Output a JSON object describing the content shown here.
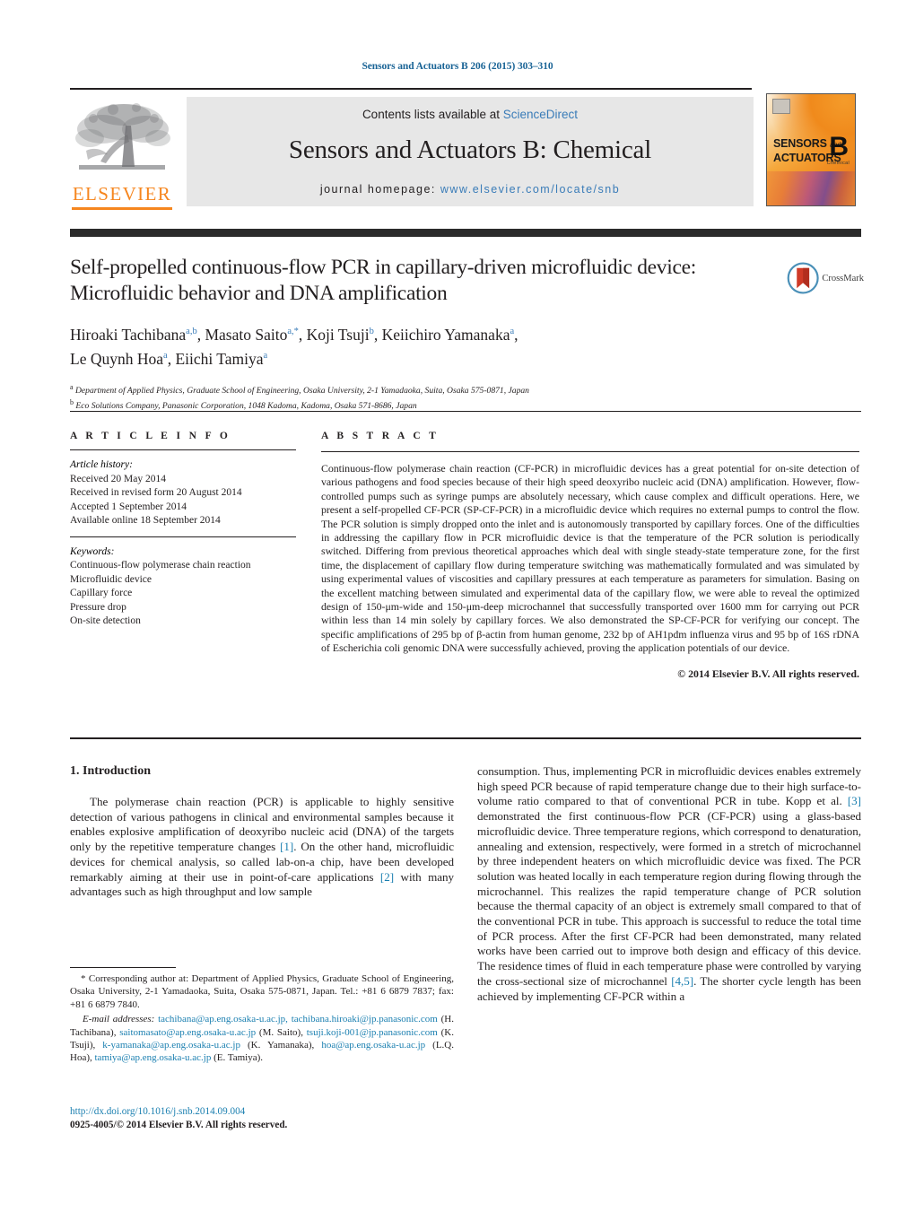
{
  "running_head": "Sensors and Actuators B 206 (2015) 303–310",
  "masthead": {
    "publisher_logo_text": "ELSEVIER",
    "contents_prefix": "Contents lists available at ",
    "contents_link": "ScienceDirect",
    "journal_title": "Sensors and Actuators B: Chemical",
    "homepage_prefix": "journal homepage: ",
    "homepage_url": "www.elsevier.com/locate/snb",
    "cover": {
      "line1": "SENSORS",
      "and": "and",
      "line2": "ACTUATORS",
      "letter": "B",
      "sub": "Chemical"
    }
  },
  "article": {
    "title": "Self-propelled continuous-flow PCR in capillary-driven microfluidic device: Microfluidic behavior and DNA amplification",
    "authors_line1_a": "Hiroaki Tachibana",
    "authors_line1_a_sup": "a,b",
    "authors_line1_b": ", Masato Saito",
    "authors_line1_b_sup": "a,*",
    "authors_line1_c": ", Koji Tsuji",
    "authors_line1_c_sup": "b",
    "authors_line1_d": ", Keiichiro Yamanaka",
    "authors_line1_d_sup": "a",
    "authors_line1_end": ",",
    "authors_line2_a": "Le Quynh Hoa",
    "authors_line2_a_sup": "a",
    "authors_line2_b": ", Eiichi Tamiya",
    "authors_line2_b_sup": "a",
    "affiliation_a_sup": "a",
    "affiliation_a": " Department of Applied Physics, Graduate School of Engineering, Osaka University, 2-1 Yamadaoka, Suita, Osaka 575-0871, Japan",
    "affiliation_b_sup": "b",
    "affiliation_b": " Eco Solutions Company, Panasonic Corporation, 1048 Kadoma, Kadoma, Osaka 571-8686, Japan",
    "crossmark_label": "CrossMark"
  },
  "article_info": {
    "heading": "A R T I C L E  I N F O",
    "history_title": "Article history:",
    "history": [
      "Received 20 May 2014",
      "Received in revised form 20 August 2014",
      "Accepted 1 September 2014",
      "Available online 18 September 2014"
    ],
    "keywords_title": "Keywords:",
    "keywords": [
      "Continuous-flow polymerase chain reaction",
      "Microfluidic device",
      "Capillary force",
      "Pressure drop",
      "On-site detection"
    ]
  },
  "abstract": {
    "heading": "A B S T R A C T",
    "text": "Continuous-flow polymerase chain reaction (CF-PCR) in microfluidic devices has a great potential for on-site detection of various pathogens and food species because of their high speed deoxyribo nucleic acid (DNA) amplification. However, flow-controlled pumps such as syringe pumps are absolutely necessary, which cause complex and difficult operations. Here, we present a self-propelled CF-PCR (SP-CF-PCR) in a microfluidic device which requires no external pumps to control the flow. The PCR solution is simply dropped onto the inlet and is autonomously transported by capillary forces. One of the difficulties in addressing the capillary flow in PCR microfluidic device is that the temperature of the PCR solution is periodically switched. Differing from previous theoretical approaches which deal with single steady-state temperature zone, for the first time, the displacement of capillary flow during temperature switching was mathematically formulated and was simulated by using experimental values of viscosities and capillary pressures at each temperature as parameters for simulation. Basing on the excellent matching between simulated and experimental data of the capillary flow, we were able to reveal the optimized design of 150-μm-wide and 150-μm-deep microchannel that successfully transported over 1600 mm for carrying out PCR within less than 14 min solely by capillary forces. We also demonstrated the SP-CF-PCR for verifying our concept. The specific amplifications of 295 bp of β-actin from human genome, 232 bp of AH1pdm influenza virus and 95 bp of 16S rDNA of Escherichia coli genomic DNA were successfully achieved, proving the application potentials of our device.",
    "copyright": "© 2014 Elsevier B.V. All rights reserved."
  },
  "body": {
    "section_heading": "1.  Introduction",
    "left_par_1_a": "The polymerase chain reaction (PCR) is applicable to highly sensitive detection of various pathogens in clinical and environmental samples because it enables explosive amplification of deoxyribo nucleic acid (DNA) of the targets only by the repetitive temperature changes ",
    "left_ref_1": "[1]",
    "left_par_1_b": ". On the other hand, microfluidic devices for chemical analysis, so called lab-on-a chip, have been developed remarkably aiming at their use in point-of-care applications ",
    "left_ref_2": "[2]",
    "left_par_1_c": " with many advantages such as high throughput and low sample",
    "right_par_1_a": "consumption. Thus, implementing PCR in microfluidic devices enables extremely high speed PCR because of rapid temperature change due to their high surface-to-volume ratio compared to that of conventional PCR in tube. Kopp et al. ",
    "right_ref_3": "[3]",
    "right_par_1_b": " demonstrated the first continuous-flow PCR (CF-PCR) using a glass-based microfluidic device. Three temperature regions, which correspond to denaturation, annealing and extension, respectively, were formed in a stretch of microchannel by three independent heaters on which microfluidic device was fixed. The PCR solution was heated locally in each temperature region during flowing through the microchannel. This realizes the rapid temperature change of PCR solution because the thermal capacity of an object is extremely small compared to that of the conventional PCR in tube. This approach is successful to reduce the total time of PCR process. After the first CF-PCR had been demonstrated, many related works have been carried out to improve both design and efficacy of this device. The residence times of fluid in each temperature phase were controlled by varying the cross-sectional size of microchannel ",
    "right_ref_45": "[4,5]",
    "right_par_1_c": ". The shorter cycle length has been achieved by implementing CF-PCR within a"
  },
  "footnotes": {
    "corresponding": "* Corresponding author at: Department of Applied Physics, Graduate School of Engineering, Osaka University, 2-1 Yamadaoka, Suita, Osaka 575-0871, Japan. Tel.: +81 6 6879 7837; fax: +81 6 6879 7840.",
    "email_label": "E-mail addresses:",
    "emails": [
      {
        "address": "tachibana@ap.eng.osaka-u.ac.jp,",
        "name": ""
      },
      {
        "address": "tachibana.hiroaki@jp.panasonic.com",
        "name": " (H. Tachibana),"
      },
      {
        "address": "saitomasato@ap.eng.osaka-u.ac.jp",
        "name": " (M. Saito), "
      },
      {
        "address": "tsuji.koji-001@jp.panasonic.com",
        "name": " (K. Tsuji), "
      },
      {
        "address": "k-yamanaka@ap.eng.osaka-u.ac.jp",
        "name": " (K. Yamanaka),"
      },
      {
        "address": "hoa@ap.eng.osaka-u.ac.jp",
        "name": " (L.Q. Hoa), "
      },
      {
        "address": "tamiya@ap.eng.osaka-u.ac.jp",
        "name": " (E. Tamiya)."
      }
    ],
    "doi": "http://dx.doi.org/10.1016/j.snb.2014.09.004",
    "issn_line": "0925-4005/© 2014 Elsevier B.V. All rights reserved."
  },
  "colors": {
    "link_blue": "#1a7fb0",
    "sciencedirect_blue": "#3a7cb8",
    "elsevier_orange": "#f6861f",
    "band_dark": "#2b2b2b",
    "text": "#231f20"
  }
}
